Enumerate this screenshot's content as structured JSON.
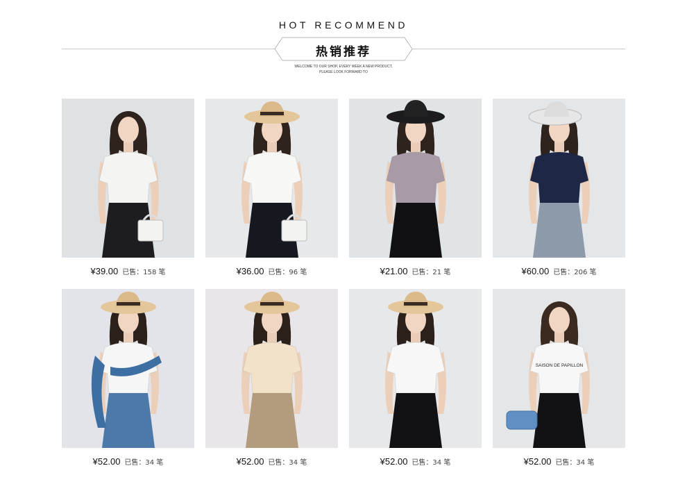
{
  "header": {
    "title_en": "HOT RECOMMEND",
    "title_cn": "热销推荐",
    "subtitle_line1": "WELCOME TO OUR SHOP, EVERY WEEK A NEW PRODUCT,",
    "subtitle_line2": "PLEASE LOOK FORWARD TO"
  },
  "products": [
    {
      "price": "¥39.00",
      "sold": "已售：158 笔",
      "top_color": "#f4f4f2",
      "bottom_color": "#1d1d1f",
      "bg": "#dfe2e4",
      "hat": "none",
      "hair": "#2e241d",
      "accessory": "white-bag"
    },
    {
      "price": "¥36.00",
      "sold": "已售：96 笔",
      "top_color": "#f7f7f5",
      "bottom_color": "#16181f",
      "bg": "#e6e8ea",
      "hat": "straw",
      "hair": "#2e241d",
      "accessory": "white-bag"
    },
    {
      "price": "¥21.00",
      "sold": "已售：21 笔",
      "top_color": "#a89aa6",
      "bottom_color": "#111114",
      "bg": "#e1e4e6",
      "hat": "black",
      "hair": "#2e241d",
      "accessory": "none"
    },
    {
      "price": "¥60.00",
      "sold": "已售：206 笔",
      "top_color": "#1f2747",
      "bottom_color": "#8c9aaa",
      "bg": "#e4e7ea",
      "hat": "white",
      "hair": "#2e241d",
      "accessory": "none"
    },
    {
      "price": "¥52.00",
      "sold": "已售：34 笔",
      "top_color": "#f6f6f6",
      "bottom_color": "#4d79a8",
      "bg": "#e3e3ea",
      "hat": "straw",
      "hair": "#2b211a",
      "accessory": "denim-jacket"
    },
    {
      "price": "¥52.00",
      "sold": "已售：34 笔",
      "top_color": "#f1e2c9",
      "bottom_color": "#b39b7e",
      "bg": "#e9e6ea",
      "hat": "straw",
      "hair": "#2b211a",
      "accessory": "none"
    },
    {
      "price": "¥52.00",
      "sold": "已售：34 笔",
      "top_color": "#f7f7f7",
      "bottom_color": "#121214",
      "bg": "#e6e8ea",
      "hat": "straw",
      "hair": "#2b211a",
      "accessory": "none"
    },
    {
      "price": "¥52.00",
      "sold": "已售：34 笔",
      "top_color": "#f7f7f7",
      "bottom_color": "#121214",
      "bg": "#e4e6e8",
      "hat": "none",
      "hair": "#3a2a20",
      "accessory": "blue-bag",
      "shirt_print": "SAISON DE PAPILLON"
    }
  ]
}
